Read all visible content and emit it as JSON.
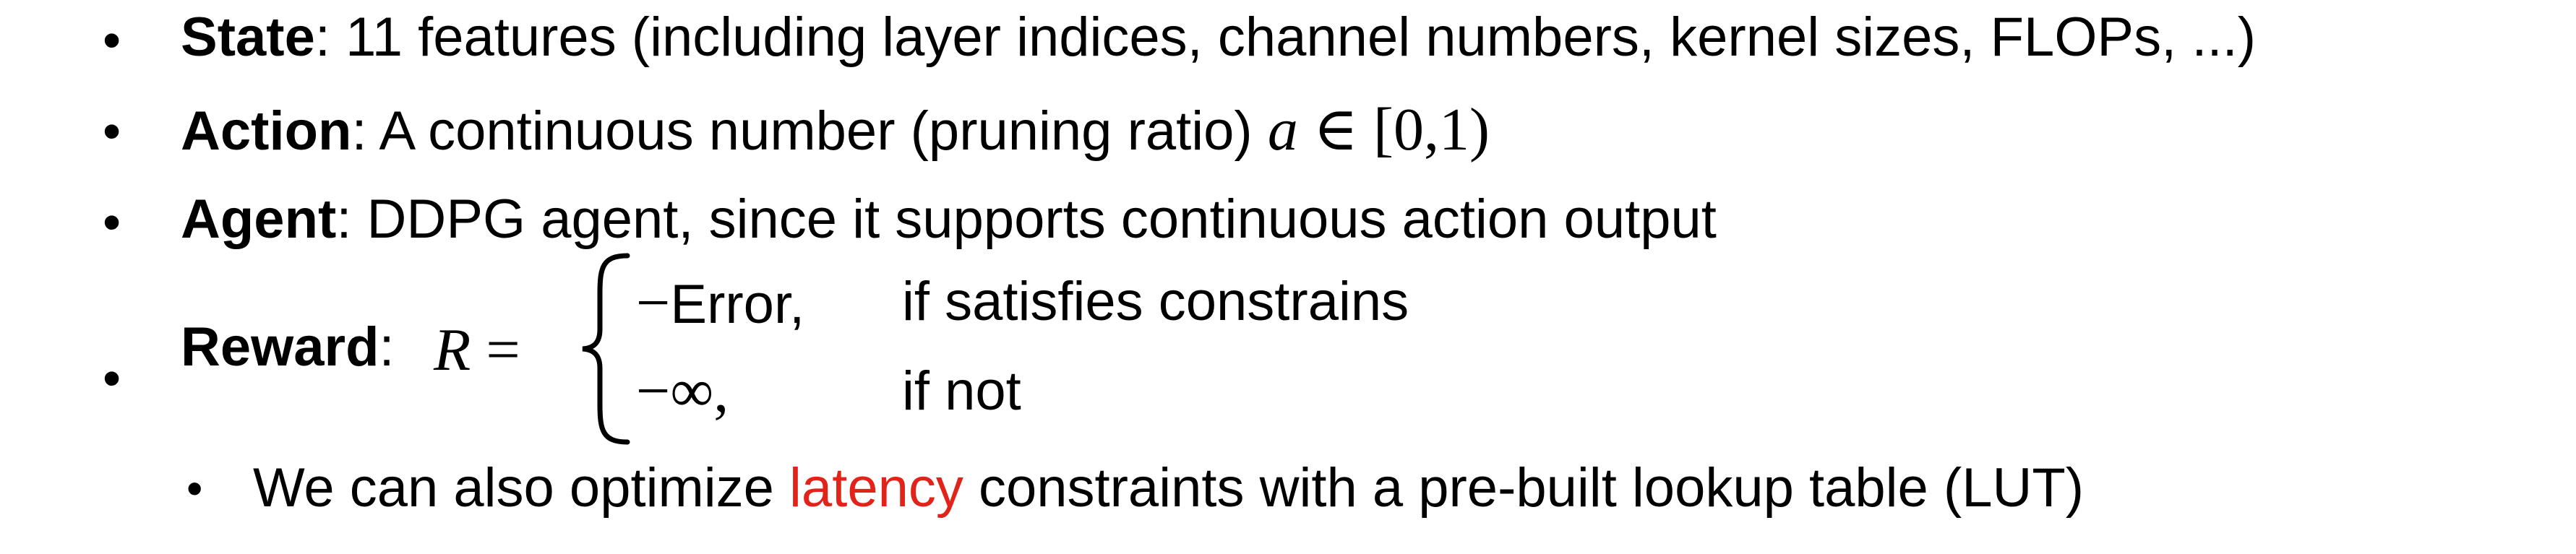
{
  "bullets": [
    {
      "term": "State",
      "text": ":  11 features (including layer indices, channel numbers, kernel sizes, FLOPs, ...)"
    },
    {
      "term": "Action",
      "text": ": A continuous number (pruning ratio) ",
      "math_var": "a",
      "math_rest": " ∈ [0,1)"
    },
    {
      "term": "Agent",
      "text": ": DDPG agent, since it supports continuous action output"
    },
    {
      "term": "Reward",
      "text": ": ",
      "math_lhs": "R",
      "math_eq": " =",
      "cases": [
        {
          "value": "Error,",
          "condition": "if satisfies constrains"
        },
        {
          "value": "∞,",
          "condition": "if not"
        }
      ],
      "neg_sign": "−"
    }
  ],
  "sub_bullet": {
    "before": "We can also optimize ",
    "highlight": "latency",
    "after": " constraints with a pre-built lookup table (LUT)"
  },
  "colors": {
    "highlight": "#e2231a",
    "text": "#000000"
  }
}
